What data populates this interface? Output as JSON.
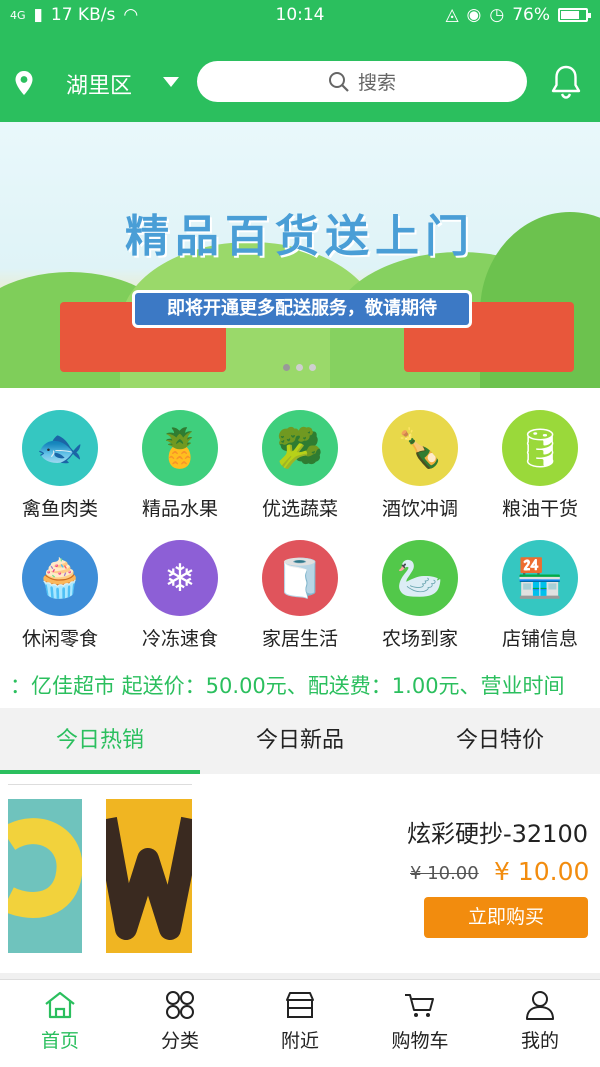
{
  "status_bar": {
    "network": "4G",
    "speed": "17 KB/s",
    "time": "10:14",
    "battery": "76%",
    "battery_level": 0.76
  },
  "header": {
    "location": "湖里区",
    "search_placeholder": "搜索"
  },
  "banner": {
    "title": "精品百货送上门",
    "subtitle": "即将开通更多配送服务，敬请期待",
    "slide_count": 3,
    "active_slide": 0
  },
  "categories": [
    {
      "label": "禽鱼肉类",
      "icon": "poultry-fish-icon",
      "color": "#35c7c1"
    },
    {
      "label": "精品水果",
      "icon": "fruit-basket-icon",
      "color": "#3fcf7d"
    },
    {
      "label": "优选蔬菜",
      "icon": "broccoli-icon",
      "color": "#3fcf7d"
    },
    {
      "label": "酒饮冲调",
      "icon": "bottles-icon",
      "color": "#e8d84a"
    },
    {
      "label": "粮油干货",
      "icon": "grain-oil-icon",
      "color": "#9ad93a"
    },
    {
      "label": "休闲零食",
      "icon": "cupcake-icon",
      "color": "#3e8ed8"
    },
    {
      "label": "冷冻速食",
      "icon": "snowflake-icon",
      "color": "#8d5fd6"
    },
    {
      "label": "家居生活",
      "icon": "tissue-roll-icon",
      "color": "#e0545c"
    },
    {
      "label": "农场到家",
      "icon": "goose-icon",
      "color": "#52c84a"
    },
    {
      "label": "店铺信息",
      "icon": "shop-icon",
      "color": "#35c7c1"
    }
  ],
  "notice": "：亿佳超市 起送价：50.00元、配送费：1.00元、营业时间",
  "tabs": [
    {
      "label": "今日热销"
    },
    {
      "label": "今日新品"
    },
    {
      "label": "今日特价"
    }
  ],
  "product": {
    "name": "炫彩硬抄-32100",
    "old_price": "¥ 10.00",
    "price": "¥ 10.00",
    "buy_label": "立即购买"
  },
  "bottom_nav": [
    {
      "label": "首页",
      "icon": "home-icon"
    },
    {
      "label": "分类",
      "icon": "category-icon"
    },
    {
      "label": "附近",
      "icon": "store-icon"
    },
    {
      "label": "购物车",
      "icon": "cart-icon"
    },
    {
      "label": "我的",
      "icon": "user-icon"
    }
  ],
  "colors": {
    "brand": "#2bbf5e",
    "accent": "#f28c0e"
  }
}
